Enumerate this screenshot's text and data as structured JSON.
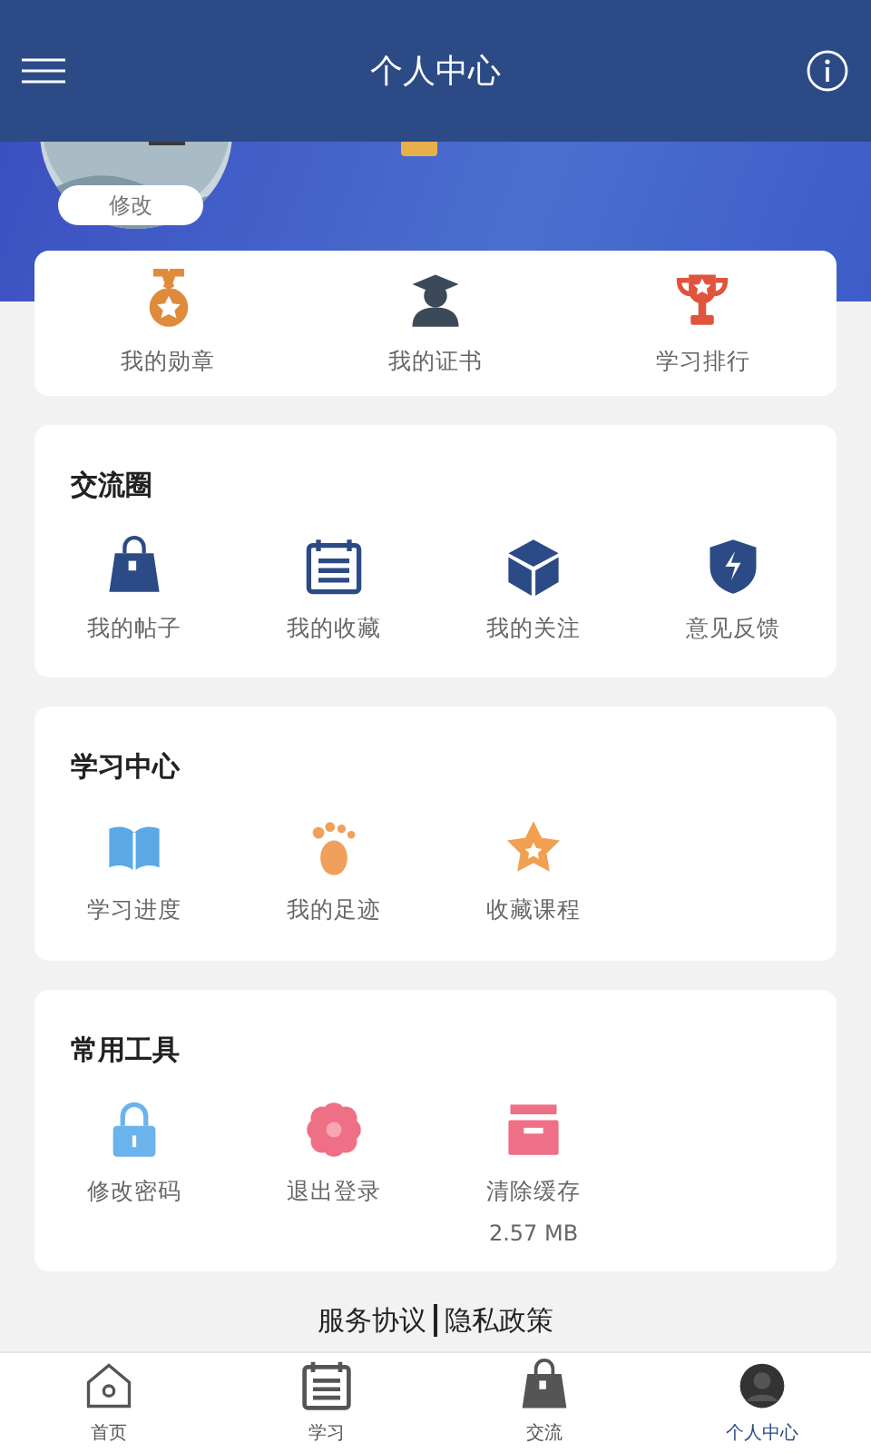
{
  "header": {
    "title": "个人中心"
  },
  "profile": {
    "edit_label": "修改"
  },
  "quick_links": [
    {
      "label": "我的勋章",
      "kind": "medal"
    },
    {
      "label": "我的证书",
      "kind": "graduate"
    },
    {
      "label": "学习排行",
      "kind": "trophy"
    }
  ],
  "sections": [
    {
      "title": "交流圈",
      "items": [
        {
          "label": "我的帖子",
          "kind": "bag"
        },
        {
          "label": "我的收藏",
          "kind": "notepad"
        },
        {
          "label": "我的关注",
          "kind": "cube"
        },
        {
          "label": "意见反馈",
          "kind": "shield"
        }
      ]
    },
    {
      "title": "学习中心",
      "items": [
        {
          "label": "学习进度",
          "kind": "book"
        },
        {
          "label": "我的足迹",
          "kind": "foot"
        },
        {
          "label": "收藏课程",
          "kind": "star"
        }
      ]
    },
    {
      "title": "常用工具",
      "items": [
        {
          "label": "修改密码",
          "kind": "lock"
        },
        {
          "label": "退出登录",
          "kind": "flower"
        },
        {
          "label": "清除缓存",
          "kind": "box",
          "detail": "2.57 MB"
        }
      ]
    }
  ],
  "footer_links": [
    "服务协议",
    "隐私政策"
  ],
  "bottom_nav": [
    {
      "label": "首页",
      "kind": "home",
      "selected": false
    },
    {
      "label": "学习",
      "kind": "notepad",
      "selected": false
    },
    {
      "label": "交流",
      "kind": "bag",
      "selected": false
    },
    {
      "label": "个人中心",
      "kind": "person",
      "selected": true
    }
  ]
}
